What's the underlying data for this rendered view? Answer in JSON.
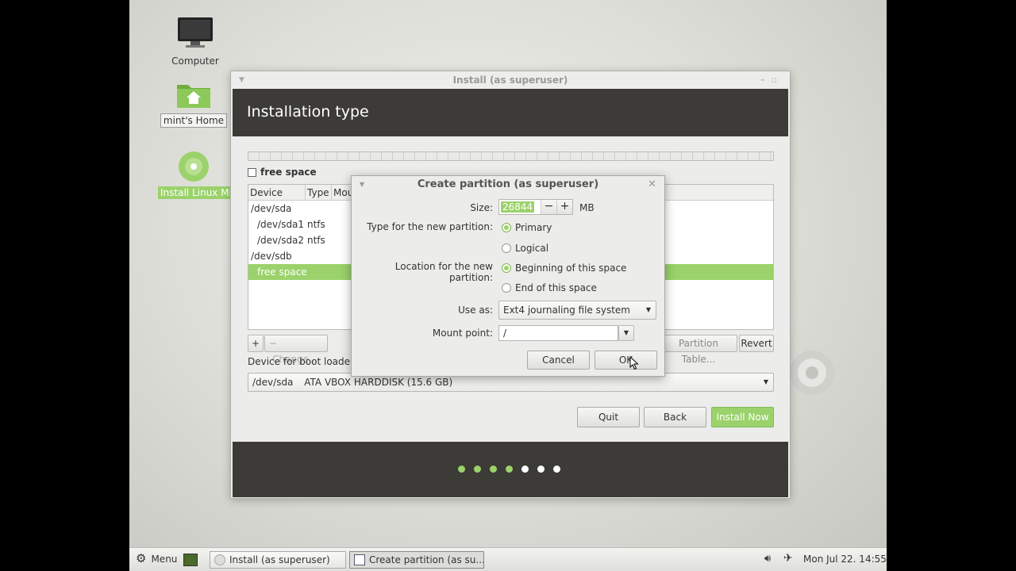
{
  "desktop": {
    "icons": [
      {
        "label": "Computer"
      },
      {
        "label": "mint's Home"
      },
      {
        "label": "Install Linux Mint"
      }
    ]
  },
  "window": {
    "title": "Install (as superuser)",
    "header": "Installation type",
    "legend_free": "free space",
    "columns": [
      "Device",
      "Type",
      "Mou"
    ],
    "rows": [
      {
        "device": "/dev/sda",
        "type": ""
      },
      {
        "device": "/dev/sda1",
        "type": "ntfs"
      },
      {
        "device": "/dev/sda2",
        "type": "ntfs"
      },
      {
        "device": "/dev/sdb",
        "type": ""
      },
      {
        "device": "free space",
        "type": ""
      }
    ],
    "add_label": "+",
    "remove_label": "−",
    "change_label": "Change...",
    "new_table_label": "Partition Table...",
    "revert_label": "Revert",
    "bootloader_label": "Device for boot loader i",
    "bootloader_device": "/dev/sda",
    "bootloader_desc": "ATA VBOX HARDDISK (15.6 GB)",
    "quit_label": "Quit",
    "back_label": "Back",
    "install_label": "Install Now",
    "progress": {
      "done": 4,
      "total": 7
    },
    "colors": {
      "accent": "#9bd26b",
      "header_bg": "#3c3b37"
    }
  },
  "dialog": {
    "title": "Create partition (as superuser)",
    "size_label": "Size:",
    "size_value": "26844",
    "size_unit": "MB",
    "type_label": "Type for the new partition:",
    "type_primary": "Primary",
    "type_logical": "Logical",
    "location_label": "Location for the new partition:",
    "location_begin": "Beginning of this space",
    "location_end": "End of this space",
    "use_as_label": "Use as:",
    "use_as_value": "Ext4 journaling file system",
    "mount_label": "Mount point:",
    "mount_value": "/",
    "cancel_label": "Cancel",
    "ok_label": "OK"
  },
  "taskbar": {
    "menu_label": "Menu",
    "tasks": [
      "Install (as superuser)",
      "Create partition (as su..."
    ],
    "clock": "Mon Jul 22. 14:55"
  }
}
